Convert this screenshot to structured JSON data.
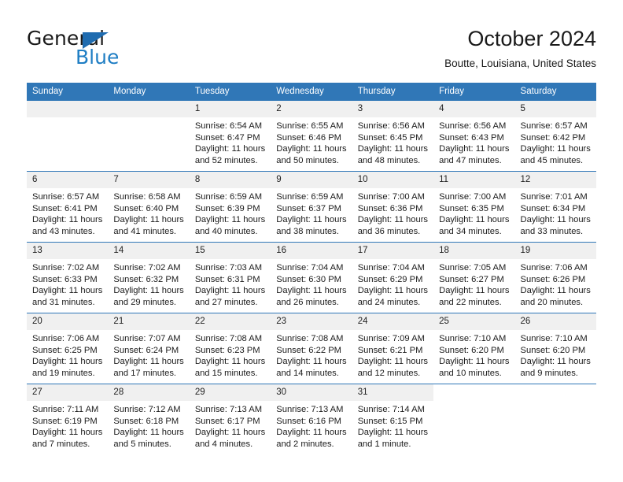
{
  "logo": {
    "word_one": "General",
    "word_two": "Blue",
    "triangle_color": "#1f6cb0",
    "blue_color": "#1f7ec4"
  },
  "header": {
    "title": "October 2024",
    "subtitle": "Boutte, Louisiana, United States",
    "header_bg": "#3077b7",
    "daynum_bg": "#f0f0f0"
  },
  "weekday_headers": [
    "Sunday",
    "Monday",
    "Tuesday",
    "Wednesday",
    "Thursday",
    "Friday",
    "Saturday"
  ],
  "labels": {
    "sunrise": "Sunrise:",
    "sunset": "Sunset:",
    "daylight": "Daylight:"
  },
  "weeks": [
    [
      {
        "day": "",
        "empty": true
      },
      {
        "day": "",
        "empty": true
      },
      {
        "day": "1",
        "sunrise": "Sunrise: 6:54 AM",
        "sunset": "Sunset: 6:47 PM",
        "daylight": "Daylight: 11 hours and 52 minutes."
      },
      {
        "day": "2",
        "sunrise": "Sunrise: 6:55 AM",
        "sunset": "Sunset: 6:46 PM",
        "daylight": "Daylight: 11 hours and 50 minutes."
      },
      {
        "day": "3",
        "sunrise": "Sunrise: 6:56 AM",
        "sunset": "Sunset: 6:45 PM",
        "daylight": "Daylight: 11 hours and 48 minutes."
      },
      {
        "day": "4",
        "sunrise": "Sunrise: 6:56 AM",
        "sunset": "Sunset: 6:43 PM",
        "daylight": "Daylight: 11 hours and 47 minutes."
      },
      {
        "day": "5",
        "sunrise": "Sunrise: 6:57 AM",
        "sunset": "Sunset: 6:42 PM",
        "daylight": "Daylight: 11 hours and 45 minutes."
      }
    ],
    [
      {
        "day": "6",
        "sunrise": "Sunrise: 6:57 AM",
        "sunset": "Sunset: 6:41 PM",
        "daylight": "Daylight: 11 hours and 43 minutes."
      },
      {
        "day": "7",
        "sunrise": "Sunrise: 6:58 AM",
        "sunset": "Sunset: 6:40 PM",
        "daylight": "Daylight: 11 hours and 41 minutes."
      },
      {
        "day": "8",
        "sunrise": "Sunrise: 6:59 AM",
        "sunset": "Sunset: 6:39 PM",
        "daylight": "Daylight: 11 hours and 40 minutes."
      },
      {
        "day": "9",
        "sunrise": "Sunrise: 6:59 AM",
        "sunset": "Sunset: 6:37 PM",
        "daylight": "Daylight: 11 hours and 38 minutes."
      },
      {
        "day": "10",
        "sunrise": "Sunrise: 7:00 AM",
        "sunset": "Sunset: 6:36 PM",
        "daylight": "Daylight: 11 hours and 36 minutes."
      },
      {
        "day": "11",
        "sunrise": "Sunrise: 7:00 AM",
        "sunset": "Sunset: 6:35 PM",
        "daylight": "Daylight: 11 hours and 34 minutes."
      },
      {
        "day": "12",
        "sunrise": "Sunrise: 7:01 AM",
        "sunset": "Sunset: 6:34 PM",
        "daylight": "Daylight: 11 hours and 33 minutes."
      }
    ],
    [
      {
        "day": "13",
        "sunrise": "Sunrise: 7:02 AM",
        "sunset": "Sunset: 6:33 PM",
        "daylight": "Daylight: 11 hours and 31 minutes."
      },
      {
        "day": "14",
        "sunrise": "Sunrise: 7:02 AM",
        "sunset": "Sunset: 6:32 PM",
        "daylight": "Daylight: 11 hours and 29 minutes."
      },
      {
        "day": "15",
        "sunrise": "Sunrise: 7:03 AM",
        "sunset": "Sunset: 6:31 PM",
        "daylight": "Daylight: 11 hours and 27 minutes."
      },
      {
        "day": "16",
        "sunrise": "Sunrise: 7:04 AM",
        "sunset": "Sunset: 6:30 PM",
        "daylight": "Daylight: 11 hours and 26 minutes."
      },
      {
        "day": "17",
        "sunrise": "Sunrise: 7:04 AM",
        "sunset": "Sunset: 6:29 PM",
        "daylight": "Daylight: 11 hours and 24 minutes."
      },
      {
        "day": "18",
        "sunrise": "Sunrise: 7:05 AM",
        "sunset": "Sunset: 6:27 PM",
        "daylight": "Daylight: 11 hours and 22 minutes."
      },
      {
        "day": "19",
        "sunrise": "Sunrise: 7:06 AM",
        "sunset": "Sunset: 6:26 PM",
        "daylight": "Daylight: 11 hours and 20 minutes."
      }
    ],
    [
      {
        "day": "20",
        "sunrise": "Sunrise: 7:06 AM",
        "sunset": "Sunset: 6:25 PM",
        "daylight": "Daylight: 11 hours and 19 minutes."
      },
      {
        "day": "21",
        "sunrise": "Sunrise: 7:07 AM",
        "sunset": "Sunset: 6:24 PM",
        "daylight": "Daylight: 11 hours and 17 minutes."
      },
      {
        "day": "22",
        "sunrise": "Sunrise: 7:08 AM",
        "sunset": "Sunset: 6:23 PM",
        "daylight": "Daylight: 11 hours and 15 minutes."
      },
      {
        "day": "23",
        "sunrise": "Sunrise: 7:08 AM",
        "sunset": "Sunset: 6:22 PM",
        "daylight": "Daylight: 11 hours and 14 minutes."
      },
      {
        "day": "24",
        "sunrise": "Sunrise: 7:09 AM",
        "sunset": "Sunset: 6:21 PM",
        "daylight": "Daylight: 11 hours and 12 minutes."
      },
      {
        "day": "25",
        "sunrise": "Sunrise: 7:10 AM",
        "sunset": "Sunset: 6:20 PM",
        "daylight": "Daylight: 11 hours and 10 minutes."
      },
      {
        "day": "26",
        "sunrise": "Sunrise: 7:10 AM",
        "sunset": "Sunset: 6:20 PM",
        "daylight": "Daylight: 11 hours and 9 minutes."
      }
    ],
    [
      {
        "day": "27",
        "sunrise": "Sunrise: 7:11 AM",
        "sunset": "Sunset: 6:19 PM",
        "daylight": "Daylight: 11 hours and 7 minutes."
      },
      {
        "day": "28",
        "sunrise": "Sunrise: 7:12 AM",
        "sunset": "Sunset: 6:18 PM",
        "daylight": "Daylight: 11 hours and 5 minutes."
      },
      {
        "day": "29",
        "sunrise": "Sunrise: 7:13 AM",
        "sunset": "Sunset: 6:17 PM",
        "daylight": "Daylight: 11 hours and 4 minutes."
      },
      {
        "day": "30",
        "sunrise": "Sunrise: 7:13 AM",
        "sunset": "Sunset: 6:16 PM",
        "daylight": "Daylight: 11 hours and 2 minutes."
      },
      {
        "day": "31",
        "sunrise": "Sunrise: 7:14 AM",
        "sunset": "Sunset: 6:15 PM",
        "daylight": "Daylight: 11 hours and 1 minute."
      },
      {
        "day": "",
        "blank": true
      },
      {
        "day": "",
        "blank": true
      }
    ]
  ]
}
